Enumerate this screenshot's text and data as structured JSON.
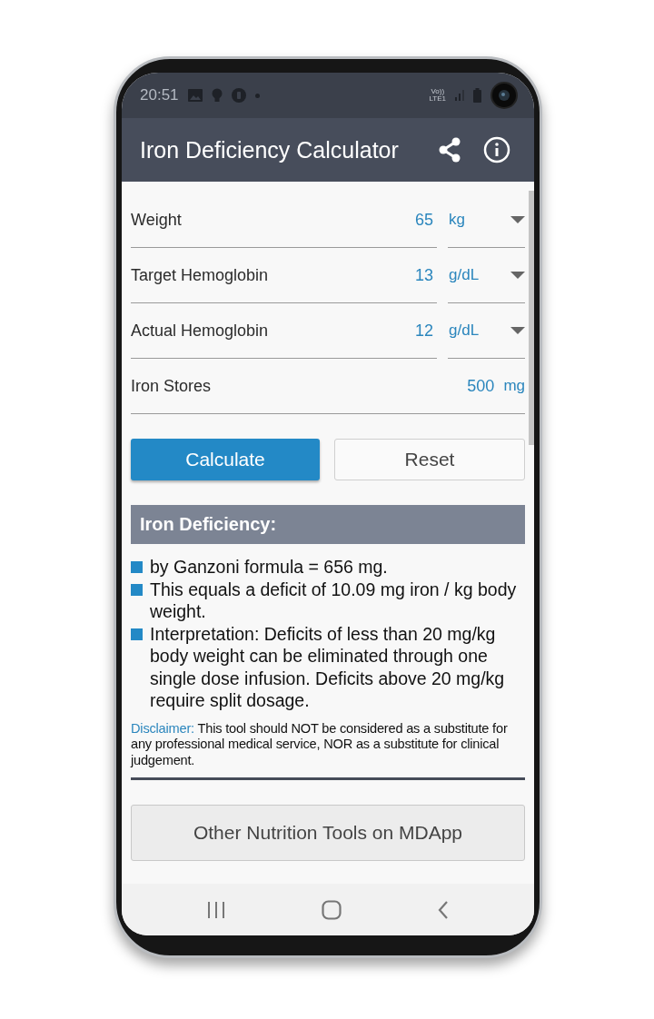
{
  "status_bar": {
    "time": "20:51",
    "network_top": "Vo))",
    "network_bottom": "LTE1"
  },
  "app_bar": {
    "title": "Iron Deficiency Calculator"
  },
  "fields": [
    {
      "kind": "select",
      "label": "Weight",
      "value": "65",
      "unit": "kg"
    },
    {
      "kind": "select",
      "label": "Target Hemoglobin",
      "value": "13",
      "unit": "g/dL"
    },
    {
      "kind": "select",
      "label": "Actual Hemoglobin",
      "value": "12",
      "unit": "g/dL"
    },
    {
      "kind": "fixed",
      "label": "Iron Stores",
      "value": "500",
      "unit": "mg"
    }
  ],
  "buttons": [
    {
      "kind": "primary",
      "label": "Calculate"
    },
    {
      "kind": "secondary",
      "label": "Reset"
    }
  ],
  "result": {
    "heading": "Iron Deficiency:",
    "items": [
      "by Ganzoni formula = 656 mg.",
      "This equals a deficit of 10.09 mg iron / kg body weight.",
      "Interpretation: Deficits of less than 20 mg/kg body weight can be eliminated through one single dose infusion. Deficits above 20 mg/kg require split dosage."
    ],
    "disclaimer_label": "Disclaimer:",
    "disclaimer_text": "This tool should NOT be considered as a substitute for any professional medical service, NOR as a substitute for clinical judgement."
  },
  "more_button": "Other Nutrition Tools on MDApp"
}
